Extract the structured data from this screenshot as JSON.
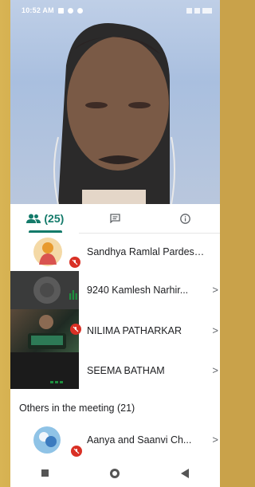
{
  "status_bar": {
    "time": "10:52 AM"
  },
  "tabs": [
    {
      "label": "(25)",
      "icon": "people-icon"
    },
    {
      "label": "",
      "icon": "chat-icon"
    },
    {
      "label": "",
      "icon": "info-icon"
    }
  ],
  "participants": [
    {
      "name": "Sandhya Ramlal Pardeshi ..."
    },
    {
      "name": "9240 Kamlesh Narhir..."
    },
    {
      "name": "NILIMA PATHARKAR"
    },
    {
      "name": "SEEMA BATHAM"
    }
  ],
  "others_heading": "Others in the meeting (21)",
  "others": [
    {
      "name": "Aanya and Saanvi Ch..."
    }
  ],
  "colors": {
    "accent": "#137a6a",
    "mute": "#d93025"
  }
}
